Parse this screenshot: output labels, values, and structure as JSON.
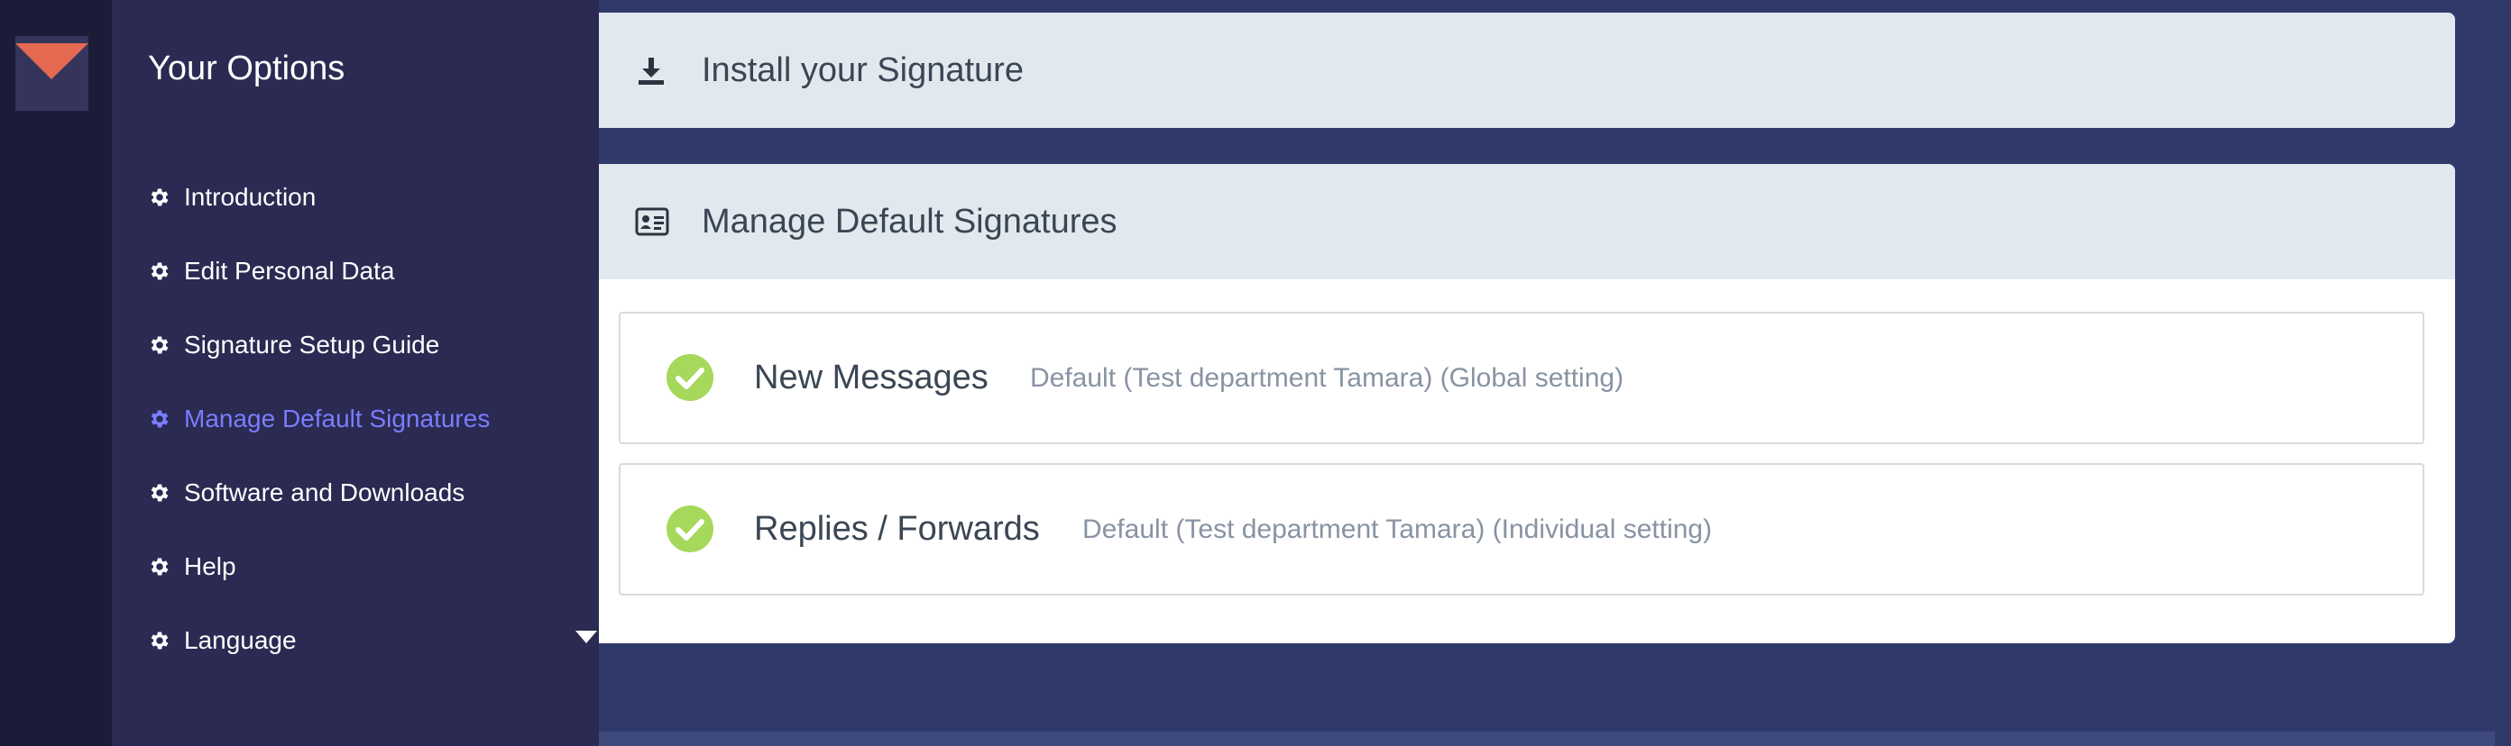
{
  "menu": {
    "title": "Your Options",
    "items": [
      {
        "label": "Introduction",
        "icon": "gear-icon"
      },
      {
        "label": "Edit Personal Data",
        "icon": "gear-icon"
      },
      {
        "label": "Signature Setup Guide",
        "icon": "gear-icon"
      },
      {
        "label": "Manage Default Signatures",
        "icon": "gear-icon",
        "active": true
      },
      {
        "label": "Software and Downloads",
        "icon": "gear-icon"
      },
      {
        "label": "Help",
        "icon": "gear-icon"
      },
      {
        "label": "Language",
        "icon": "gear-icon",
        "dropdown": true
      }
    ]
  },
  "install": {
    "title": "Install your Signature",
    "icon": "download-icon"
  },
  "manage": {
    "title": "Manage Default Signatures",
    "icon": "id-card-icon",
    "rows": [
      {
        "name": "New Messages",
        "description": "Default (Test department Tamara) (Global setting)",
        "status_icon": "check-circle-icon"
      },
      {
        "name": "Replies / Forwards",
        "description": "Default (Test department Tamara) (Individual setting)",
        "status_icon": "check-circle-icon"
      }
    ]
  },
  "colors": {
    "accent": "#7b7dff",
    "logo": "#e36a50",
    "success": "#a6d85b",
    "sidebar": "#2a2a52",
    "background": "#2f3a6b"
  }
}
